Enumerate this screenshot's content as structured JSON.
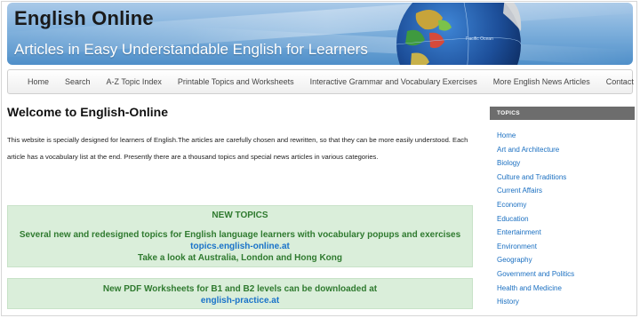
{
  "header": {
    "title": "English Online",
    "subtitle": "Articles in Easy Understandable English for Learners",
    "globe_label": "Pacific Ocean"
  },
  "nav": {
    "items": [
      "Home",
      "Search",
      "A-Z Topic Index",
      "Printable Topics and Worksheets",
      "Interactive Grammar and Vocabulary Exercises",
      "More English News Articles",
      "Contact"
    ]
  },
  "main": {
    "heading": "Welcome to English-Online",
    "intro": "This website is specially designed for learners of English.The articles are carefully chosen and rewritten, so that they can be more easily understood. Each article has a vocabulary list at the end. Presently there are a thousand topics and special news articles in various categories."
  },
  "new_topics": {
    "heading": "NEW TOPICS",
    "text": "Several new and redesigned topics for English language learners with vocabulary popups and exercises",
    "link": "topics.english-online.at",
    "tagline": "Take a look at Australia, London and Hong Kong"
  },
  "worksheets": {
    "text": "New PDF Worksheets for B1 and B2 levels can be downloaded at",
    "link": "english-practice.at"
  },
  "sidebar": {
    "heading": "TOPICS",
    "items": [
      "Home",
      "Art and Architecture",
      "Biology",
      "Culture and Traditions",
      "Current Affairs",
      "Economy",
      "Education",
      "Entertainment",
      "Environment",
      "Geography",
      "Government and Politics",
      "Health and Medicine",
      "History"
    ]
  },
  "colors": {
    "box_background": "#daeeda",
    "box_text": "#2f7a2f",
    "link": "#1a73c9",
    "sidebar_header": "#6d6d6d"
  }
}
